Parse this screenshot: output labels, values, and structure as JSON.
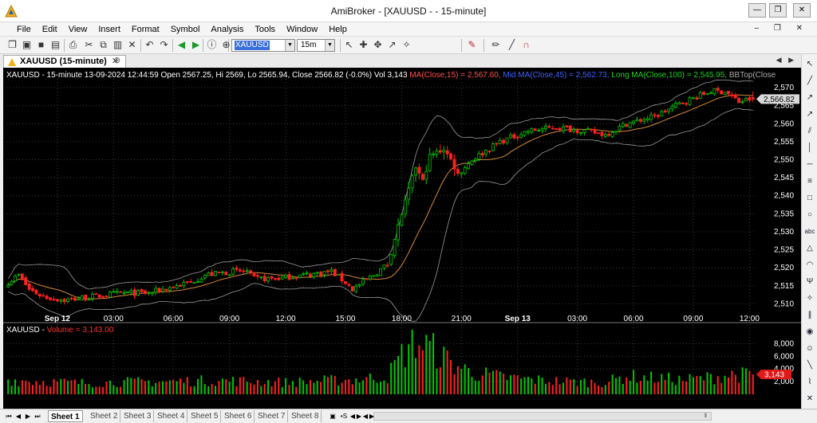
{
  "window": {
    "title": "AmiBroker - [XAUUSD -  - 15-minute]",
    "min_glyph": "—",
    "max_glyph": "❐",
    "close_glyph": "✕"
  },
  "menu": {
    "items": [
      "File",
      "Edit",
      "View",
      "Insert",
      "Format",
      "Symbol",
      "Analysis",
      "Tools",
      "Window",
      "Help"
    ]
  },
  "mdi_controls": "– ❐ ✕",
  "toolbar": {
    "symbol": "XAUUSD",
    "interval": "15m",
    "icons": [
      {
        "name": "new-icon",
        "glyph": "❐"
      },
      {
        "name": "open-icon",
        "glyph": "▣"
      },
      {
        "name": "save-icon",
        "glyph": "■"
      },
      {
        "name": "save-all-icon",
        "glyph": "▤"
      },
      {
        "name": "print-icon",
        "glyph": "⎙"
      },
      {
        "name": "cut-icon",
        "glyph": "✂"
      },
      {
        "name": "copy-icon",
        "glyph": "⧉"
      },
      {
        "name": "paste-icon",
        "glyph": "▥"
      },
      {
        "name": "delete-icon",
        "glyph": "✕"
      },
      {
        "name": "undo-icon",
        "glyph": "↶"
      },
      {
        "name": "redo-icon",
        "glyph": "↷"
      },
      {
        "name": "back-icon",
        "glyph": "◀"
      },
      {
        "name": "forward-icon",
        "glyph": "▶"
      },
      {
        "name": "info-icon",
        "glyph": "ⓘ"
      },
      {
        "name": "zoom-icon",
        "glyph": "⊕"
      },
      {
        "name": "cursor-icon",
        "glyph": "↖"
      },
      {
        "name": "crosshair-icon",
        "glyph": "✚"
      },
      {
        "name": "pan-icon",
        "glyph": "✥"
      },
      {
        "name": "select-icon",
        "glyph": "↗"
      },
      {
        "name": "wand-icon",
        "glyph": "✧"
      },
      {
        "name": "color-pen-icon",
        "glyph": "✎"
      },
      {
        "name": "pencil-icon",
        "glyph": "✏"
      },
      {
        "name": "line-width-icon",
        "glyph": "╱"
      },
      {
        "name": "magnet-icon",
        "glyph": "∩"
      }
    ]
  },
  "tab": {
    "label": "XAUUSD (15-minute)",
    "close_glyph": "✕",
    "new_tab_glyph": "⊕",
    "nav_glyphs": "◀ ▶"
  },
  "price_pane": {
    "info_prefix": "XAUUSD - 15-minute 13-09-2024 12:44:59 Open 2567.25, Hi 2569, Lo 2565.94, Close 2566.82 (-0.0%) Vol 3,143",
    "ma_text": "MA(Close,15) = 2,567.60,",
    "mid_ma_text": "Mid MA(Close,45) = 2,562.73,",
    "long_ma_text": "Long MA(Close,100) = 2,545.95,",
    "bbtop_text": "BBTop(Close",
    "last_price_label": "2,566.82",
    "y_ticks": [
      "2,510",
      "2,515",
      "2,520",
      "2,525",
      "2,530",
      "2,535",
      "2,540",
      "2,545",
      "2,550",
      "2,555",
      "2,560",
      "2,565",
      "2,570"
    ],
    "x_ticks": [
      "Sep 12",
      "03:00",
      "06:00",
      "09:00",
      "12:00",
      "15:00",
      "18:00",
      "21:00",
      "Sep 13",
      "03:00",
      "06:00",
      "09:00",
      "12:00"
    ]
  },
  "volume_pane": {
    "info_prefix": "XAUUSD -",
    "volume_text": "Volume = 3,143.00",
    "y_ticks": [
      "2,000",
      "4,000",
      "6,000",
      "8,000"
    ],
    "last_volume_label": "3,143"
  },
  "colors": {
    "up": "#00c800",
    "down": "#ff2020",
    "ma": "#d48a3a",
    "band": "#9a9a9a",
    "grid": "#3a3a3a",
    "ma_label": "#ff5050",
    "mid_ma_label": "#4060ff",
    "long_ma_label": "#20d020",
    "bbtop_label": "#aaaaaa"
  },
  "chart_data": {
    "type": "candlestick",
    "symbol": "XAUUSD",
    "interval": "15-minute",
    "last_bar": {
      "datetime": "13-09-2024 12:44:59",
      "open": 2567.25,
      "high": 2569,
      "low": 2565.94,
      "close": 2566.82,
      "volume": 3143
    },
    "indicators": {
      "MA(Close,15)": 2567.6,
      "Mid MA(Close,45)": 2562.73,
      "Long MA(Close,100)": 2545.95
    },
    "price_ylim": [
      2507,
      2572
    ],
    "volume_ylim": [
      0,
      9300
    ],
    "x_labels": [
      "Sep 12",
      "03:00",
      "06:00",
      "09:00",
      "12:00",
      "15:00",
      "18:00",
      "21:00",
      "Sep 13",
      "03:00",
      "06:00",
      "09:00",
      "12:00"
    ],
    "close_anchors": [
      [
        0,
        2516
      ],
      [
        3,
        2518
      ],
      [
        6,
        2514
      ],
      [
        10,
        2512
      ],
      [
        16,
        2511
      ],
      [
        24,
        2512
      ],
      [
        32,
        2513
      ],
      [
        40,
        2513
      ],
      [
        44,
        2514
      ],
      [
        52,
        2516
      ],
      [
        56,
        2518
      ],
      [
        64,
        2519
      ],
      [
        68,
        2519
      ],
      [
        70,
        2517
      ],
      [
        76,
        2517
      ],
      [
        84,
        2518
      ],
      [
        92,
        2519
      ],
      [
        96,
        2516
      ],
      [
        98,
        2514
      ],
      [
        104,
        2518
      ],
      [
        108,
        2521
      ],
      [
        112,
        2535
      ],
      [
        116,
        2548
      ],
      [
        118,
        2544
      ],
      [
        120,
        2551
      ],
      [
        124,
        2553
      ],
      [
        126,
        2550
      ],
      [
        128,
        2546
      ],
      [
        132,
        2550
      ],
      [
        140,
        2555
      ],
      [
        148,
        2558
      ],
      [
        156,
        2559
      ],
      [
        164,
        2558
      ],
      [
        170,
        2557
      ],
      [
        176,
        2560
      ],
      [
        184,
        2562
      ],
      [
        192,
        2566
      ],
      [
        200,
        2569
      ],
      [
        204,
        2569
      ],
      [
        208,
        2566
      ],
      [
        212,
        2567
      ]
    ],
    "volume_anchors": [
      [
        0,
        2400
      ],
      [
        20,
        1900
      ],
      [
        40,
        2100
      ],
      [
        60,
        2300
      ],
      [
        80,
        2000
      ],
      [
        100,
        2500
      ],
      [
        108,
        3000
      ],
      [
        112,
        6500
      ],
      [
        116,
        8700
      ],
      [
        120,
        7800
      ],
      [
        126,
        5200
      ],
      [
        132,
        3600
      ],
      [
        140,
        2900
      ],
      [
        150,
        2400
      ],
      [
        160,
        2100
      ],
      [
        170,
        2000
      ],
      [
        176,
        3000
      ],
      [
        184,
        2700
      ],
      [
        192,
        2400
      ],
      [
        200,
        2800
      ],
      [
        206,
        3300
      ],
      [
        212,
        3143
      ]
    ]
  },
  "sheets": {
    "tabs": [
      "Sheet 1",
      "Sheet 2",
      "Sheet 3",
      "Sheet 4",
      "Sheet 5",
      "Sheet 6",
      "Sheet 7",
      "Sheet 8"
    ],
    "active": 0,
    "nav_glyphs": [
      "⏮",
      "◀",
      "▶",
      "⏭"
    ],
    "lock_glyph": "▣",
    "fx_label": "•S",
    "scroll_glyph": "‖"
  },
  "right_tools": [
    {
      "name": "arrow-cursor-icon",
      "glyph": "↖"
    },
    {
      "name": "trendline-icon",
      "glyph": "╱"
    },
    {
      "name": "ray-icon",
      "glyph": "↗"
    },
    {
      "name": "extended-line-icon",
      "glyph": "↗"
    },
    {
      "name": "channel-icon",
      "glyph": "⫽"
    },
    {
      "name": "vertical-line-icon",
      "glyph": "│"
    },
    {
      "name": "horizontal-line-icon",
      "glyph": "─"
    },
    {
      "name": "fibonacci-icon",
      "glyph": "≡"
    },
    {
      "name": "rectangle-icon",
      "glyph": "□"
    },
    {
      "name": "ellipse-icon",
      "glyph": "○"
    },
    {
      "name": "text-icon",
      "glyph": "abc"
    },
    {
      "name": "triangle-icon",
      "glyph": "△"
    },
    {
      "name": "arc-icon",
      "glyph": "◠"
    },
    {
      "name": "pitchfork-icon",
      "glyph": "Ψ"
    },
    {
      "name": "gann-icon",
      "glyph": "✧"
    },
    {
      "name": "cycles-icon",
      "glyph": "∥"
    },
    {
      "name": "marker-icon",
      "glyph": "◉"
    },
    {
      "name": "smiley-icon",
      "glyph": "☺"
    },
    {
      "name": "regression-icon",
      "glyph": "╲"
    },
    {
      "name": "zigzag-icon",
      "glyph": "⌇"
    },
    {
      "name": "delete-drawings-icon",
      "glyph": "✕"
    }
  ]
}
